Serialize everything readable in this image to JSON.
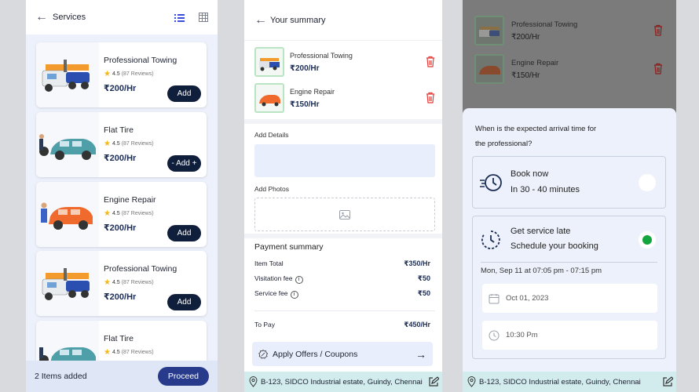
{
  "services": {
    "title": "Services",
    "cards": [
      {
        "name": "Professional Towing",
        "rating": "4.5",
        "reviews": "(87 Reviews)",
        "price": "₹200/Hr",
        "action": "Add"
      },
      {
        "name": "Flat Tire",
        "rating": "4.5",
        "reviews": "(87 Reviews)",
        "price": "₹200/Hr",
        "action": "- Add +"
      },
      {
        "name": "Engine Repair",
        "rating": "4.5",
        "reviews": "(87 Reviews)",
        "price": "₹200/Hr",
        "action": "Add"
      },
      {
        "name": "Professional Towing",
        "rating": "4.5",
        "reviews": "(87 Reviews)",
        "price": "₹200/Hr",
        "action": "Add"
      },
      {
        "name": "Flat Tire",
        "rating": "4.5",
        "reviews": "(87 Reviews)",
        "price": "",
        "action": ""
      }
    ],
    "footer": {
      "count": "2 Items added",
      "proceed": "Proceed"
    }
  },
  "summary": {
    "title": "Your summary",
    "items": [
      {
        "name": "Professional Towing",
        "price": "₹200/Hr"
      },
      {
        "name": "Engine Repair",
        "price": "₹150/Hr"
      }
    ],
    "add_details": "Add Details",
    "add_photos": "Add Photos",
    "payment_title": "Payment summary",
    "rows": [
      {
        "label": "Item Total",
        "value": "₹350/Hr",
        "info": false
      },
      {
        "label": "Visitation fee",
        "value": "₹50",
        "info": true
      },
      {
        "label": "Service fee",
        "value": "₹50",
        "info": true
      }
    ],
    "to_pay_label": "To Pay",
    "to_pay_value": "₹450/Hr",
    "offers": "Apply Offers / Coupons",
    "address": "B-123, SIDCO Industrial estate, Guindy, Chennai"
  },
  "schedule": {
    "items": [
      {
        "name": "Professional Towing",
        "price": "₹200/Hr"
      },
      {
        "name": "Engine Repair",
        "price": "₹150/Hr"
      }
    ],
    "question": "When is the expected arrival time for the professional?",
    "book_now": {
      "title": "Book now",
      "sub": "In 30 - 40 minutes"
    },
    "later": {
      "title": "Get service late",
      "sub": "Schedule your booking"
    },
    "date_line": "Mon, Sep 11 at 07:05 pm - 07:15 pm",
    "date": "Oct 01, 2023",
    "time": "10:30 Pm",
    "address": "B-123, SIDCO Industrial estate, Guindy, Chennai"
  },
  "colors": {
    "accent": "#0f1e3b",
    "delete": "#e53935",
    "selected": "#12a43d",
    "address_bar": "#d2ecee"
  }
}
